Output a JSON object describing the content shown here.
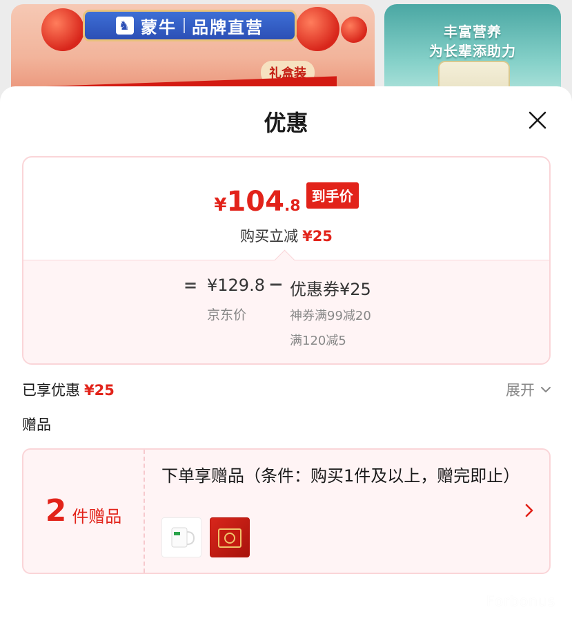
{
  "background": {
    "banner_left": {
      "brand_name": "蒙牛",
      "brand_tagline": "品牌直营",
      "badge": "礼盒装"
    },
    "banner_right": {
      "line1": "丰富营养",
      "line2": "为长辈添助力"
    }
  },
  "sheet": {
    "title": "优惠",
    "close_icon": "close-icon"
  },
  "price_summary": {
    "final_currency": "¥",
    "final_integer": "104",
    "final_decimal": ".8",
    "final_tag": "到手价",
    "instant_discount_label": "购买立减",
    "instant_discount_amount": "¥25",
    "breakdown": {
      "equals": "=",
      "base_price": "¥129.8",
      "base_label": "京东价",
      "minus": "−",
      "coupon": "优惠券¥25",
      "coupon_detail_1": "神券满99减20",
      "coupon_detail_2": "满120减5"
    }
  },
  "enjoyed": {
    "label": "已享优惠",
    "amount": "¥25",
    "expand_label": "展开"
  },
  "gifts": {
    "heading": "赠品",
    "count": "2",
    "count_label": "件赠品",
    "description": "下单享赠品（条件：购买1件及以上，赠完即止）",
    "items": [
      "mug-thumbnail",
      "gift-box-thumbnail"
    ]
  },
  "watermark": "Forbonus",
  "colors": {
    "accent_red": "#e2231a",
    "card_border": "#fad5d8",
    "card_tint": "#fff4f5"
  }
}
